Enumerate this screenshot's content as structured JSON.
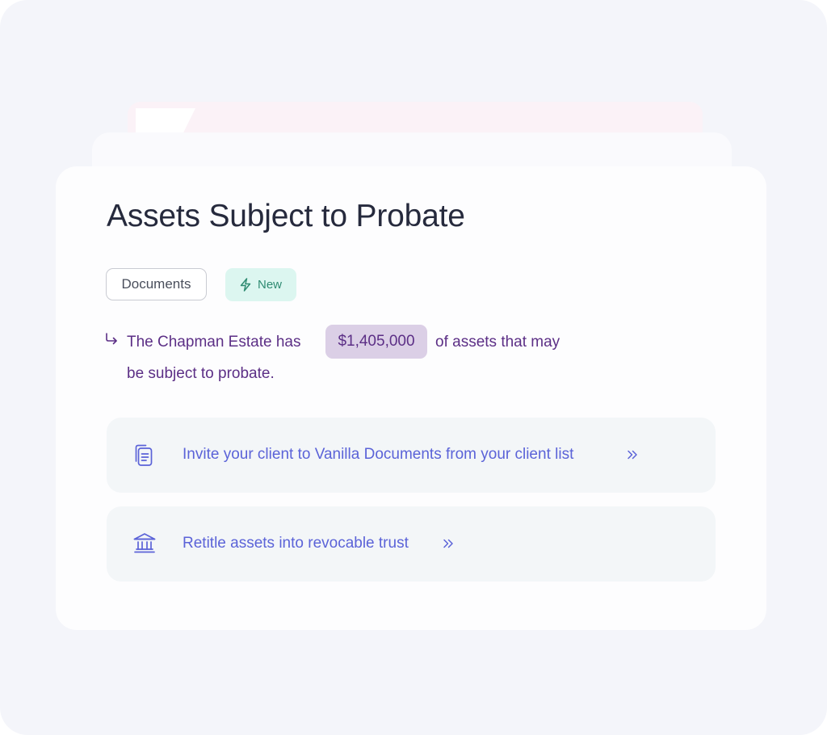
{
  "card": {
    "title": "Assets Subject to Probate",
    "tags": {
      "documents_label": "Documents",
      "new_label": "New",
      "new_icon": "lightning-icon"
    },
    "description": {
      "prefix": "The Chapman Estate has",
      "amount": "$1,405,000",
      "suffix": "of assets that may",
      "line2": "be subject  to probate."
    },
    "actions": [
      {
        "icon": "document-icon",
        "label": "Invite your client to Vanilla Documents from your client list"
      },
      {
        "icon": "bank-icon",
        "label": "Retitle assets into revocable trust"
      }
    ]
  },
  "colors": {
    "title": "#262a3d",
    "accent_purple": "#5c2f86",
    "amount_bg": "#dbcfe6",
    "link_blue": "#5b63d8",
    "new_tag_bg": "#dcf6f0",
    "new_tag_text": "#2f8b72",
    "action_bg": "#f3f6f8"
  }
}
